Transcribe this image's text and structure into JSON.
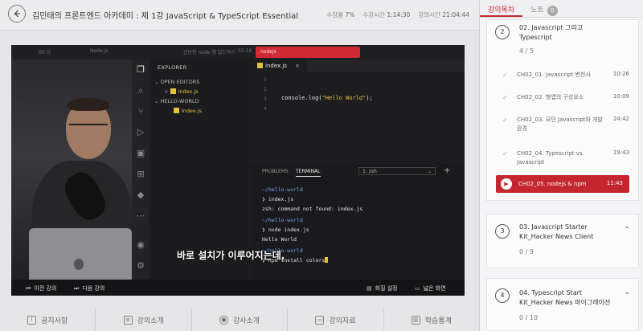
{
  "header": {
    "back_icon": "arrow-left-icon",
    "title": "김민태의 프론트엔드 아카데미 : 제 1강 JavaScript & TypeScript Essential",
    "progress_label": "수강률",
    "progress_value": "7%",
    "watch_time_label": "수강시간",
    "watch_time_value": "1:14:30",
    "total_time_label": "강의시간",
    "total_time_value": "21:04:44"
  },
  "video": {
    "top_tabs": [
      "00:상",
      "Node.js",
      "",
      "간단한 node 앱 빌드하기",
      "02:18"
    ],
    "red_tab": "nodejs",
    "explorer_title": "EXPLORER",
    "open_editors_label": "OPEN EDITORS",
    "open_file": "index.js",
    "folder_label": "HELLO-WORLD",
    "folder_file": "index.js",
    "editor_tab": "index.js",
    "line_numbers": [
      "1",
      "2",
      "3",
      "4"
    ],
    "code_prefix": "console.log(",
    "code_string": "\"Hello World\"",
    "code_suffix": ");",
    "terminal_tabs": [
      "PROBLEMS",
      "TERMINAL"
    ],
    "terminal_select": "1: zsh",
    "terminal_lines": [
      {
        "type": "path",
        "text": "~/hello-world"
      },
      {
        "type": "cmd",
        "text": "❯ index.js"
      },
      {
        "type": "out",
        "text": "zsh: command not found: index.js"
      },
      {
        "type": "path",
        "text": "~/hello-world"
      },
      {
        "type": "cmd",
        "text": "❯ node index.js"
      },
      {
        "type": "out",
        "text": "Hello World"
      },
      {
        "type": "path",
        "text": "~/hello-world"
      },
      {
        "type": "cmd",
        "text": "❯ npm install colors"
      }
    ],
    "subtitle": "바로 설치가 이루어지는데,",
    "controls": {
      "prev": "이전 강의",
      "next": "다음 강의",
      "quality": "화질 설정",
      "wide": "넓은 화면"
    }
  },
  "bottom_tabs": [
    {
      "icon": "notice-icon",
      "label": "공지사항"
    },
    {
      "icon": "book-icon",
      "label": "강의소개"
    },
    {
      "icon": "person-icon",
      "label": "강사소개"
    },
    {
      "icon": "folder-icon",
      "label": "강의자료"
    },
    {
      "icon": "chart-icon",
      "label": "학습통계"
    }
  ],
  "sidebar": {
    "tab_curriculum": "강의목차",
    "tab_notes": "노트",
    "notes_count": "0",
    "sections": [
      {
        "num": "2",
        "title": "02. Javascript 그리고 Typescript",
        "progress": "4 / 5"
      },
      {
        "num": "3",
        "title": "03. Javascript Starter Kit_Hacker News Client",
        "progress": "0 / 9"
      },
      {
        "num": "4",
        "title": "04. Typescript Start Kit_Hacker News 마이그레이션",
        "progress": "0 / 10"
      }
    ],
    "lessons": [
      {
        "title": "CH02_01. Javascript 변천사",
        "time": "10:26"
      },
      {
        "title": "CH02_02. 형앱의 구성요소",
        "time": "10:09"
      },
      {
        "title": "CH02_03. 모던 Javascript와 개발 환경",
        "time": "24:42"
      },
      {
        "title": "CH02_04. Typescript vs. Javascript",
        "time": "19:43"
      },
      {
        "title": "CH02_05. nodejs & npm",
        "time": "11:43"
      }
    ]
  },
  "colors": {
    "accent": "#c3262f",
    "terminal_path": "#6fa3e8",
    "js_yellow": "#e6c13a"
  }
}
